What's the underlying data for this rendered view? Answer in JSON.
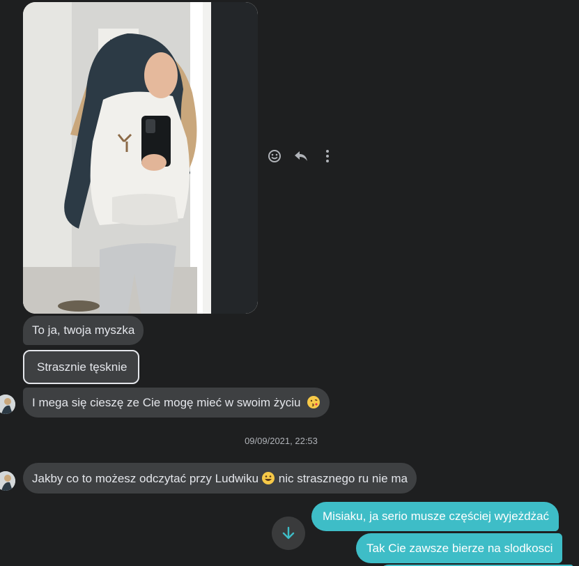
{
  "conversation": {
    "photo_label": "shared-photo",
    "messages_in": [
      "To ja, twoja myszka",
      "Strasznie tęsknie",
      "I mega się cieszę ze Cie mogę mieć w swoim życiu",
      "Jakby co to możesz odczytać przy Ludwiku",
      " nic strasznego ru nie ma"
    ],
    "timestamp": "09/09/2021, 22:53",
    "messages_out": [
      "Misiaku, ja serio musze częściej wyjeżdżać",
      "Tak Cie zawsze bierze na slodkosci"
    ]
  },
  "actions": {
    "react_icon": "smiley-icon",
    "reply_icon": "reply-icon",
    "more_icon": "more-vertical-icon"
  },
  "colors": {
    "background": "#1e1f20",
    "incoming_bubble": "#3e4042",
    "outgoing_bubble": "#3ebdc7",
    "text": "#e4e6eb",
    "muted": "#b0b3b8"
  }
}
